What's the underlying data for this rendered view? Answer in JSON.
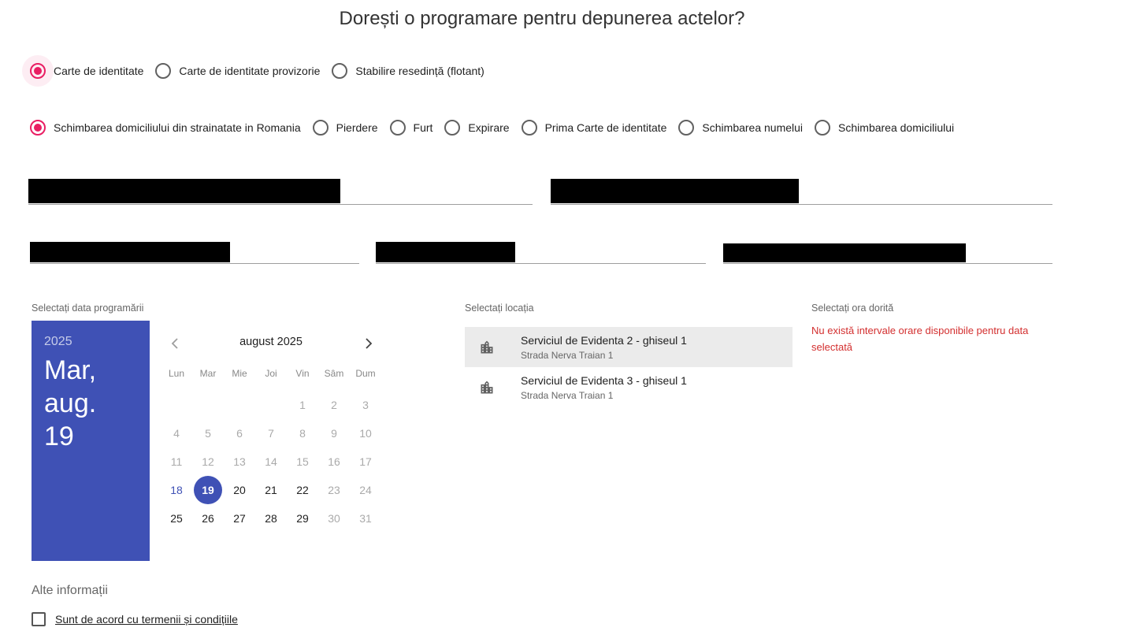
{
  "title": "Dorești o programare pentru depunerea actelor?",
  "doc_types": [
    {
      "label": "Carte de identitate",
      "selected": true
    },
    {
      "label": "Carte de identitate provizorie",
      "selected": false
    },
    {
      "label": "Stabilire resedință (flotant)",
      "selected": false
    }
  ],
  "reasons": [
    {
      "label": "Schimbarea domiciliului din strainatate in Romania",
      "selected": true
    },
    {
      "label": "Pierdere",
      "selected": false
    },
    {
      "label": "Furt",
      "selected": false
    },
    {
      "label": "Expirare",
      "selected": false
    },
    {
      "label": "Prima Carte de identitate",
      "selected": false
    },
    {
      "label": "Schimbarea numelui",
      "selected": false
    },
    {
      "label": "Schimbarea domiciliului",
      "selected": false
    }
  ],
  "date_section": {
    "label": "Selectați data programării",
    "year": "2025",
    "selected_date": "Mar, aug. 19",
    "month_label": "august 2025",
    "weekdays": [
      "Lun",
      "Mar",
      "Mie",
      "Joi",
      "Vin",
      "Sâm",
      "Dum"
    ],
    "weeks": [
      [
        "",
        "",
        "",
        "",
        "1",
        "2",
        "3"
      ],
      [
        "4",
        "5",
        "6",
        "7",
        "8",
        "9",
        "10"
      ],
      [
        "11",
        "12",
        "13",
        "14",
        "15",
        "16",
        "17"
      ],
      [
        "18",
        "19",
        "20",
        "21",
        "22",
        "23",
        "24"
      ],
      [
        "25",
        "26",
        "27",
        "28",
        "29",
        "30",
        "31"
      ]
    ]
  },
  "location_section": {
    "label": "Selectați locația",
    "locations": [
      {
        "name": "Serviciul de Evidenta 2 - ghiseul 1",
        "address": "Strada Nerva Traian 1",
        "active": true
      },
      {
        "name": "Serviciul de Evidenta 3 - ghiseul 1",
        "address": "Strada Nerva Traian 1",
        "active": false
      }
    ]
  },
  "time_section": {
    "label": "Selectați ora dorită",
    "message": "Nu există intervale orare disponibile pentru data selectată"
  },
  "other_info_label": "Alte informații",
  "terms_label": "Sunt de acord cu termenii și condițiile",
  "colors": {
    "accent": "#e91e63",
    "primary": "#3f51b5",
    "error": "#d32f2f"
  },
  "icons": {
    "location": "building-icon",
    "prev": "chevron-left-icon",
    "next": "chevron-right-icon"
  }
}
